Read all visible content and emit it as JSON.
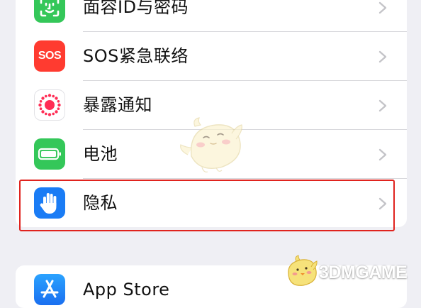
{
  "settings": {
    "rows": [
      {
        "label": "面容ID与密码",
        "icon": "face-id-icon",
        "color": "#34c759"
      },
      {
        "label": "SOS紧急联络",
        "icon": "sos-icon",
        "icon_text": "SOS",
        "color": "#ff3b30"
      },
      {
        "label": "暴露通知",
        "icon": "exposure-notification-icon",
        "color": "#ff2d55"
      },
      {
        "label": "电池",
        "icon": "battery-icon",
        "color": "#34c759"
      },
      {
        "label": "隐私",
        "icon": "hand-icon",
        "color": "#1a7cf5"
      }
    ],
    "group2": [
      {
        "label": "App Store",
        "icon": "app-store-icon",
        "color": "#1e90ff"
      }
    ]
  },
  "highlight_color": "#e0231e",
  "watermark": {
    "text": "3DMGAME"
  }
}
